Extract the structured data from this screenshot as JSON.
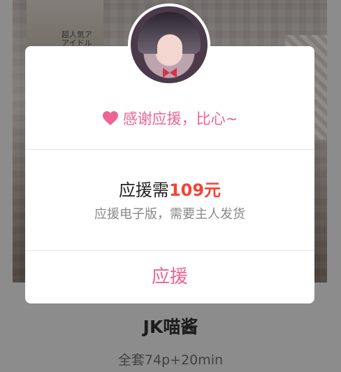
{
  "background": {
    "cover_text": "超人気ア\nアイドル"
  },
  "product": {
    "title": "JK喵酱",
    "subtitle": "全套74p+20min"
  },
  "dialog": {
    "thanks_text": "感谢应援，比心~",
    "price_prefix": "应援需",
    "price_value": "109元",
    "note": "应援电子版，需要主人发货",
    "support_button_label": "应援"
  },
  "colors": {
    "accent_pink": "#f06292",
    "price_red": "#f44336"
  },
  "icons": {
    "thanks": "heart-icon"
  }
}
